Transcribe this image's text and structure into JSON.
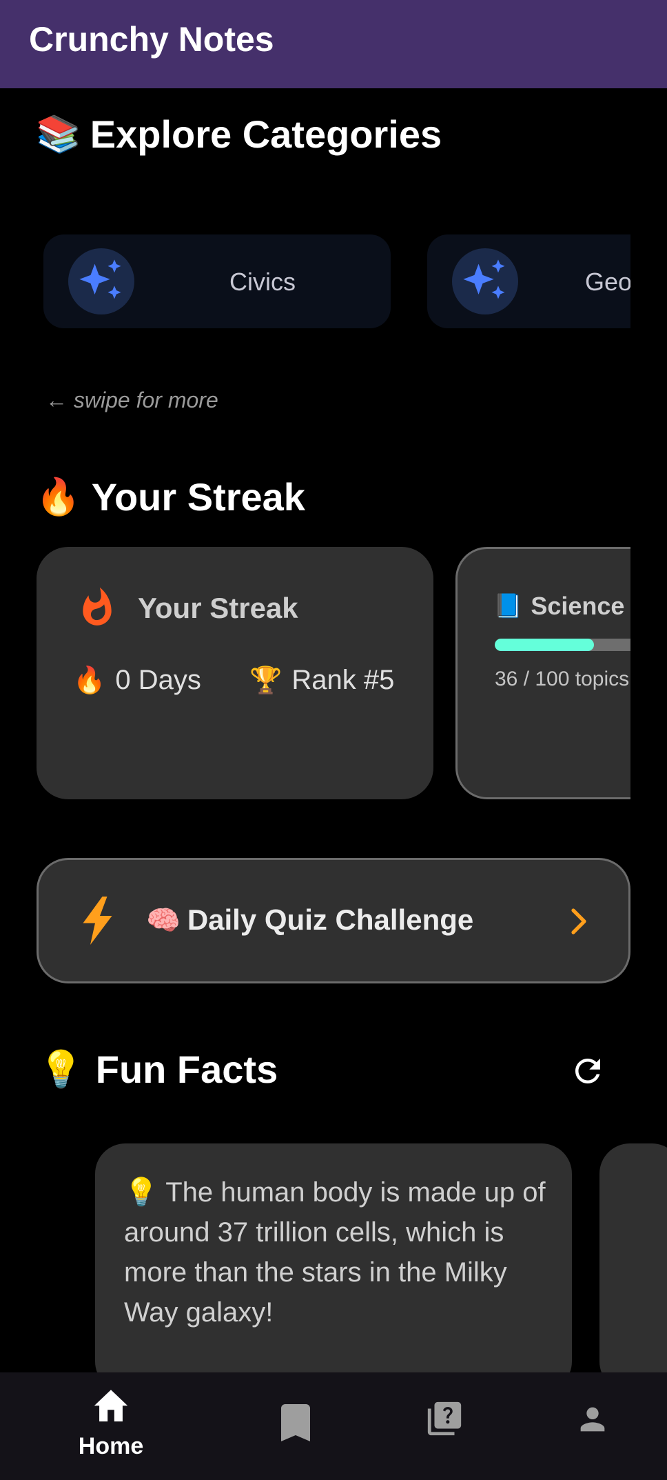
{
  "app": {
    "title": "Crunchy Notes"
  },
  "categories": {
    "title_emoji": "📚",
    "title": "Explore Categories",
    "items": [
      {
        "label": "Civics",
        "icon": "sparkles-icon"
      },
      {
        "label": "Geography",
        "icon": "sparkles-icon"
      }
    ],
    "swipe_hint": "← swipe for more"
  },
  "streak_section": {
    "title_emoji": "🔥",
    "title": "Your Streak",
    "card": {
      "title": "Your Streak",
      "days_emoji": "🔥",
      "days": "0 Days",
      "rank_emoji": "🏆",
      "rank": "Rank #5"
    },
    "science": {
      "emoji": "📘",
      "title": "Science",
      "progress_count": "36 / 100 topics",
      "progress_value": 0.36
    }
  },
  "quiz": {
    "emoji": "🧠",
    "label": "Daily Quiz Challenge"
  },
  "fun_facts": {
    "title_emoji": "💡",
    "title": "Fun Facts",
    "fact_emoji": "💡",
    "fact": "The human body is made up of around 37 trillion cells, which is more than the stars in the Milky Way galaxy!"
  },
  "nav": {
    "home_label": "Home",
    "items": [
      "home-icon",
      "bookmark-icon",
      "quiz-icon",
      "profile-icon"
    ]
  },
  "colors": {
    "appbar": "#45306b",
    "accent_orange": "#ff9f1c",
    "progress": "#64ffda",
    "sparkle": "#4a7dff"
  }
}
